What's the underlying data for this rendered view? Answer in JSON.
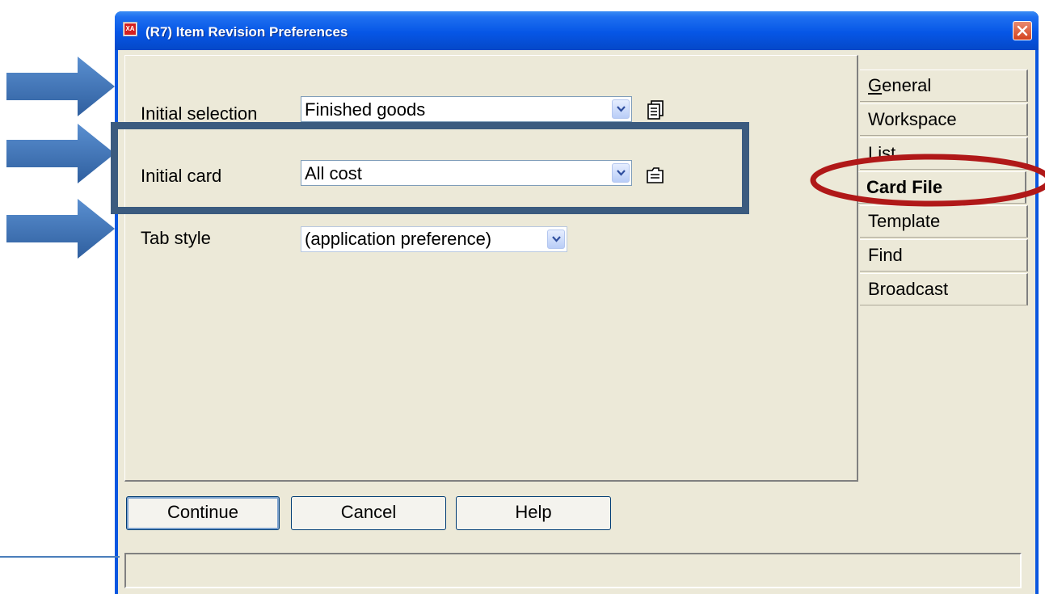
{
  "window": {
    "title": "(R7) Item Revision Preferences",
    "app_icon_text": "XA"
  },
  "fields": {
    "initial_selection": {
      "label": "Initial selection",
      "value": "Finished goods"
    },
    "initial_card": {
      "label": "Initial card",
      "value": "All cost"
    },
    "tab_style": {
      "label": "Tab style",
      "value": "(application preference)"
    }
  },
  "tabs": [
    {
      "label": "General",
      "active": false
    },
    {
      "label": "Workspace",
      "active": false
    },
    {
      "label": "List",
      "active": false
    },
    {
      "label": "Card File",
      "active": true
    },
    {
      "label": "Template",
      "active": false
    },
    {
      "label": "Find",
      "active": false
    },
    {
      "label": "Broadcast",
      "active": false
    }
  ],
  "buttons": {
    "continue": "Continue",
    "cancel": "Cancel",
    "help": "Help"
  },
  "status_text": "",
  "colors": {
    "titlebar": "#0656e6",
    "dialog_bg": "#ece9d8",
    "arrow": "#3f72b4",
    "highlight_box": "#3b5b7f",
    "ellipse": "#b01818"
  },
  "icons": [
    "app-icon",
    "close-icon",
    "dropdown-arrow-icon",
    "selection-list-icon",
    "card-file-icon",
    "arrow-icon"
  ]
}
